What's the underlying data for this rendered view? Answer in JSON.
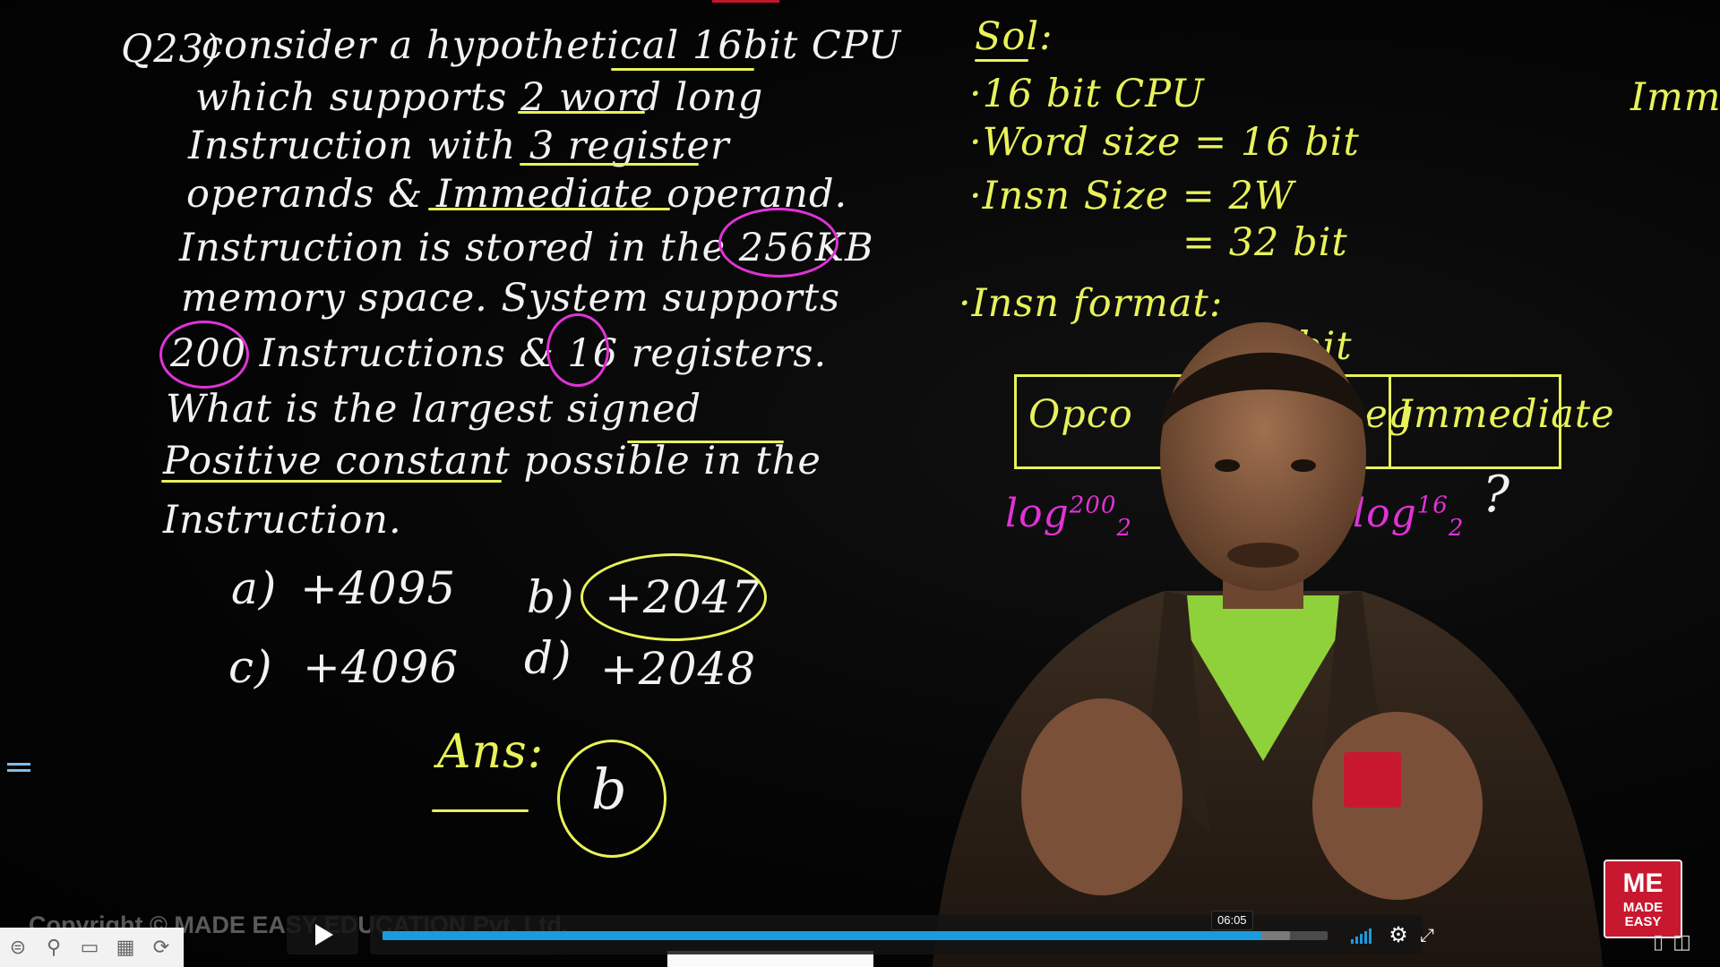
{
  "board": {
    "question": {
      "number": "Q23)",
      "lines": [
        "consider a hypothetical 16bit CPU",
        "which supports 2 word long",
        "Instruction with 3 register",
        "operands & Immediate operand.",
        "Instruction is stored in the 256KB",
        "memory space. System supports",
        "200 Instructions & 16 registers.",
        "What is the largest signed",
        "Positive constant possible in the",
        "Instruction."
      ]
    },
    "options": [
      {
        "label": "a)",
        "value": "+4095"
      },
      {
        "label": "b)",
        "value": "+2047"
      },
      {
        "label": "c)",
        "value": "+4096"
      },
      {
        "label": "d)",
        "value": "+2048"
      }
    ],
    "answer_label": "Ans:",
    "answer_value": "b",
    "solution": {
      "title": "Sol:",
      "lines": [
        "·16 bit CPU",
        "·Word size = 16 bit",
        "·Insn Size = 2W",
        "= 32 bit"
      ],
      "format_label": "·Insn format:",
      "bit_text": "bit",
      "fields": [
        "Opco",
        "Reg",
        "Immediate"
      ],
      "log_opcode": "log",
      "log_opcode_sup": "200",
      "log_opcode_sub": "2",
      "log_reg": "log",
      "log_reg_sup": "16",
      "log_reg_sub": "2",
      "unknown": "?",
      "edge_text": "Imme"
    }
  },
  "branding": {
    "logo_top": "ME",
    "logo_bottom": "MADE EASY",
    "copyright": "Copyright © MADE EASY EDUCATION Pvt. Ltd."
  },
  "player": {
    "time_tooltip": "06:05",
    "progress": 0.93,
    "buffered": 0.96,
    "icons": {
      "play": "play-icon",
      "volume": "volume-icon",
      "settings": "gear-icon",
      "fullscreen": "fullscreen-icon"
    }
  },
  "toolbar": {
    "icons": [
      "menu-icon",
      "pin-icon",
      "briefcase-icon",
      "calendar-icon",
      "replay-icon"
    ]
  },
  "colors": {
    "chalk_yellow": "#e8f25a",
    "chalk_magenta": "#e033d6",
    "progress_blue": "#1a9be0",
    "brand_red": "#c8182f"
  }
}
